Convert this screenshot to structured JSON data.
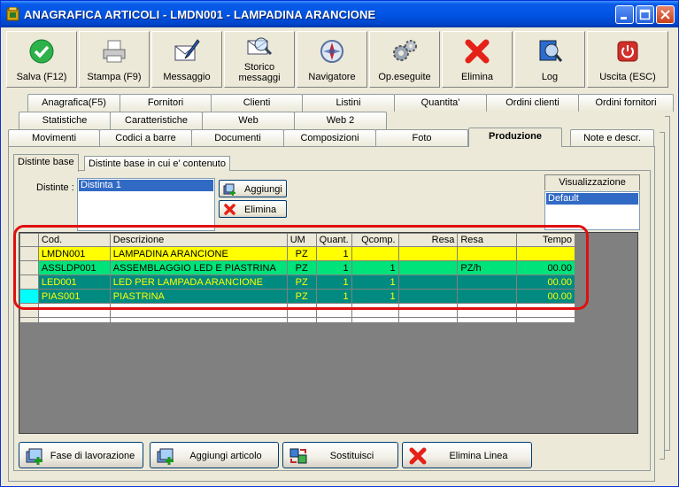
{
  "window": {
    "title": "ANAGRAFICA ARTICOLI - LMDN001 - LAMPADINA ARANCIONE"
  },
  "toolbar": [
    {
      "label": "Salva (F12)",
      "icon": "check-icon"
    },
    {
      "label": "Stampa (F9)",
      "icon": "printer-icon"
    },
    {
      "label": "Messaggio",
      "icon": "envelope-pen-icon"
    },
    {
      "label": "Storico messaggi",
      "line1": "Storico",
      "line2": "messaggi",
      "icon": "envelope-search-icon"
    },
    {
      "label": "Navigatore",
      "icon": "compass-icon"
    },
    {
      "label": "Op.eseguite",
      "icon": "gears-icon"
    },
    {
      "label": "Elimina",
      "icon": "red-x-icon"
    },
    {
      "label": "Log",
      "icon": "book-search-icon"
    },
    {
      "label": "Uscita (ESC)",
      "icon": "power-icon"
    }
  ],
  "tabs": {
    "row1": [
      "Anagrafica(F5)",
      "Fornitori",
      "Clienti",
      "Listini",
      "Quantita'",
      "Ordini clienti",
      "Ordini fornitori"
    ],
    "row2": [
      "Statistiche",
      "Caratteristiche",
      "Web",
      "Web 2"
    ],
    "row3": [
      "Movimenti",
      "Codici a barre",
      "Documenti",
      "Composizioni",
      "Foto",
      "Produzione",
      "Note e descr."
    ],
    "active": "Produzione"
  },
  "subtabs": [
    "Distinte base",
    "Distinte base in cui e' contenuto"
  ],
  "distinte": {
    "label": "Distinte :",
    "selected": "Distinta 1",
    "add_label": "Aggiungi",
    "delete_label": "Elimina"
  },
  "visualizzazione": {
    "header": "Visualizzazione",
    "selected": "Default"
  },
  "grid": {
    "columns": [
      "Cod.",
      "Descrizione",
      "UM",
      "Quant.",
      "Qcomp.",
      "Resa",
      "Resa",
      "Tempo"
    ],
    "rows": [
      {
        "cod": "LMDN001",
        "descrizione": "LAMPADINA ARANCIONE",
        "um": "PZ",
        "quant": "1",
        "qcomp": "",
        "resa": "",
        "resa2": "",
        "tempo": "",
        "bg": "#ffff00",
        "fg": "#000000"
      },
      {
        "cod": "ASSLDP001",
        "descrizione": "ASSEMBLAGGIO LED E PIASTRINA",
        "um": "PZ",
        "quant": "1",
        "qcomp": "1",
        "resa": "",
        "resa2": "PZ/h",
        "tempo": "00.00",
        "bg": "#00e27a",
        "fg": "#000000"
      },
      {
        "cod": "LED001",
        "descrizione": "LED PER LAMPADA ARANCIONE",
        "um": "PZ",
        "quant": "1",
        "qcomp": "1",
        "resa": "",
        "resa2": "",
        "tempo": "00.00",
        "bg": "#008a80",
        "fg": "#ffff00"
      },
      {
        "cod": "PIAS001",
        "descrizione": "PIASTRINA",
        "um": "PZ",
        "quant": "1",
        "qcomp": "1",
        "resa": "",
        "resa2": "",
        "tempo": "00.00",
        "bg": "#008a80",
        "fg": "#ffff00"
      }
    ]
  },
  "bottom_buttons": [
    {
      "label": "Fase di lavorazione",
      "icon": "add-process-icon"
    },
    {
      "label": "Aggiungi articolo",
      "icon": "add-item-icon"
    },
    {
      "label": "Sostituisci",
      "icon": "replace-icon"
    },
    {
      "label": "Elimina Linea",
      "icon": "red-x-icon"
    }
  ]
}
